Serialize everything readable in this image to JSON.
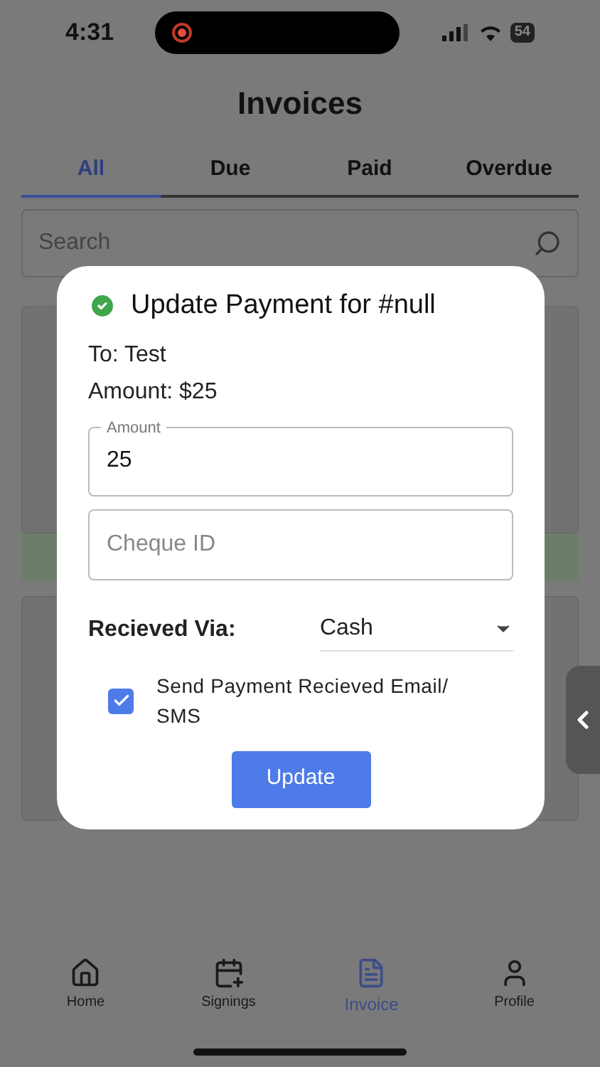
{
  "status_bar": {
    "time": "4:31",
    "battery": "54"
  },
  "title": "Invoices",
  "tabs": [
    {
      "label": "All",
      "selected": true
    },
    {
      "label": "Due",
      "selected": false
    },
    {
      "label": "Paid",
      "selected": false
    },
    {
      "label": "Overdue",
      "selected": false
    }
  ],
  "search": {
    "placeholder": "Search"
  },
  "dialog": {
    "title": "Update Payment for #null",
    "to": "To: Test",
    "amount": "Amount: $25",
    "amount_field": {
      "label": "Amount",
      "value": "25"
    },
    "cheque_field": {
      "placeholder": "Cheque ID"
    },
    "received_via": {
      "label": "Recieved Via:",
      "value": "Cash"
    },
    "send_notice": {
      "label": "Send Payment Recieved Email/ SMS",
      "checked": true
    },
    "button": "Update"
  },
  "nav": [
    {
      "label": "Home",
      "kind": "home",
      "selected": false
    },
    {
      "label": "Signings",
      "kind": "calendar",
      "selected": false
    },
    {
      "label": "Invoice",
      "kind": "file",
      "selected": true
    },
    {
      "label": "Profile",
      "kind": "user",
      "selected": false
    }
  ]
}
